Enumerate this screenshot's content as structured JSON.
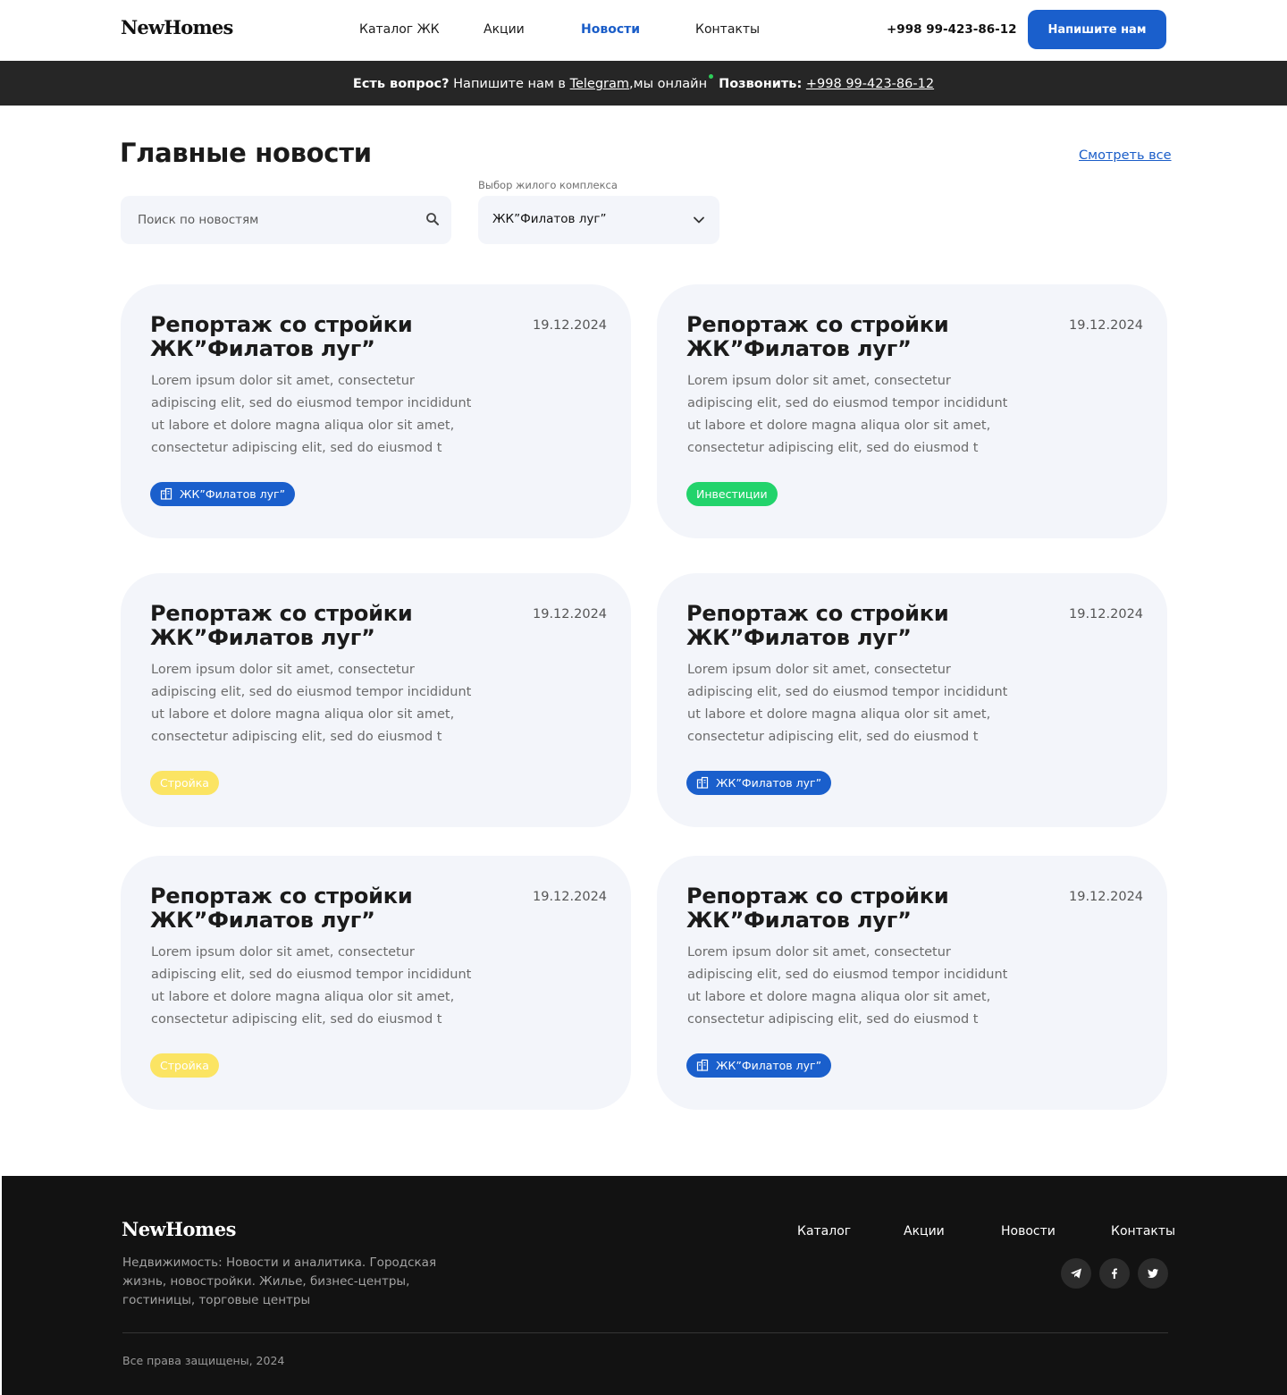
{
  "header": {
    "logo": "NewHomes",
    "nav": [
      {
        "label": "Каталог ЖК",
        "active": false
      },
      {
        "label": "Акции",
        "active": false
      },
      {
        "label": "Новости",
        "active": true
      },
      {
        "label": "Контакты",
        "active": false
      }
    ],
    "phone": "+998 99-423-86-12",
    "cta_label": "Напишите нам"
  },
  "infobar": {
    "question": "Есть вопрос?",
    "write_text": "Напишите нам в",
    "telegram": "Telegram",
    "online_text": ",мы онлайн",
    "call_label": "Позвонить:",
    "phone": "+998 99-423-86-12"
  },
  "main": {
    "title": "Главные новости",
    "see_all": "Смотреть все",
    "search": {
      "placeholder": "Поиск по новостям",
      "value": ""
    },
    "select": {
      "label": "Выбор жилого комплекса",
      "value": "ЖК”Филатов луг”"
    }
  },
  "news": [
    {
      "title": "Репортаж со стройки ЖК”Филатов луг”",
      "date": "19.12.2024",
      "text": "Lorem ipsum dolor sit amet, consectetur adipiscing elit, sed do eiusmod tempor incididunt ut labore et dolore magna aliqua olor sit amet, consectetur adipiscing elit, sed do eiusmod t",
      "tag": "ЖК”Филатов луг”",
      "tag_type": "complex"
    },
    {
      "title": "Репортаж со стройки ЖК”Филатов луг”",
      "date": "19.12.2024",
      "text": "Lorem ipsum dolor sit amet, consectetur adipiscing elit, sed do eiusmod tempor incididunt ut labore et dolore magna aliqua olor sit amet, consectetur adipiscing elit, sed do eiusmod t",
      "tag": "Инвестиции",
      "tag_type": "invest"
    },
    {
      "title": "Репортаж со стройки ЖК”Филатов луг”",
      "date": "19.12.2024",
      "text": "Lorem ipsum dolor sit amet, consectetur adipiscing elit, sed do eiusmod tempor incididunt ut labore et dolore magna aliqua olor sit amet, consectetur adipiscing elit, sed do eiusmod t",
      "tag": "Стройка",
      "tag_type": "build"
    },
    {
      "title": "Репортаж со стройки ЖК”Филатов луг”",
      "date": "19.12.2024",
      "text": "Lorem ipsum dolor sit amet, consectetur adipiscing elit, sed do eiusmod tempor incididunt ut labore et dolore magna aliqua olor sit amet, consectetur adipiscing elit, sed do eiusmod t",
      "tag": "ЖК”Филатов луг”",
      "tag_type": "complex"
    },
    {
      "title": "Репортаж со стройки ЖК”Филатов луг”",
      "date": "19.12.2024",
      "text": "Lorem ipsum dolor sit amet, consectetur adipiscing elit, sed do eiusmod tempor incididunt ut labore et dolore magna aliqua olor sit amet, consectetur adipiscing elit, sed do eiusmod t",
      "tag": "Стройка",
      "tag_type": "build"
    },
    {
      "title": "Репортаж со стройки ЖК”Филатов луг”",
      "date": "19.12.2024",
      "text": "Lorem ipsum dolor sit amet, consectetur adipiscing elit, sed do eiusmod tempor incididunt ut labore et dolore magna aliqua olor sit amet, consectetur adipiscing elit, sed do eiusmod t",
      "tag": "ЖК”Филатов луг”",
      "tag_type": "complex"
    }
  ],
  "footer": {
    "logo": "NewHomes",
    "description": "Недвижимость: Новости и аналитика. Городская жизнь, новостройки. Жилье, бизнес-центры, гостиницы, торговые центры",
    "nav": [
      "Каталог",
      "Акции",
      "Новости",
      "Контакты"
    ],
    "social": [
      "telegram-icon",
      "facebook-icon",
      "twitter-icon"
    ],
    "copyright": "Все права защищены, 2024"
  },
  "colors": {
    "accent": "#1a5fcc",
    "invest_tag": "#22d36b",
    "build_tag": "#fbe463",
    "card_bg": "#f3f5fa",
    "infobar_bg": "#262626",
    "footer_bg": "#121212",
    "online_dot": "#2ecc59"
  }
}
